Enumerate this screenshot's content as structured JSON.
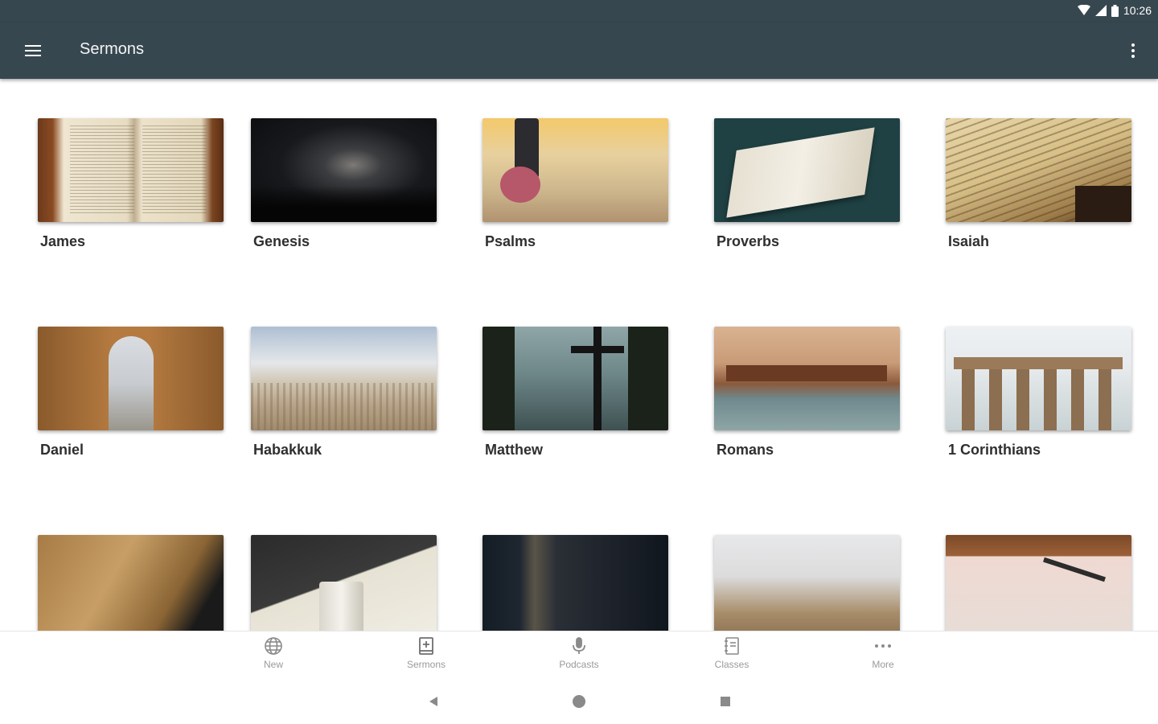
{
  "status_bar": {
    "time": "10:26",
    "icons": [
      "wifi-icon",
      "cell-signal-icon",
      "battery-icon"
    ]
  },
  "app_bar": {
    "title": "Sermons",
    "menu_icon": "hamburger-menu-icon",
    "overflow_icon": "more-vert-icon"
  },
  "series": [
    {
      "label": "James"
    },
    {
      "label": "Genesis"
    },
    {
      "label": "Psalms"
    },
    {
      "label": "Proverbs"
    },
    {
      "label": "Isaiah"
    },
    {
      "label": "Daniel"
    },
    {
      "label": "Habakkuk"
    },
    {
      "label": "Matthew"
    },
    {
      "label": "Romans"
    },
    {
      "label": "1 Corinthians"
    },
    {
      "label": ""
    },
    {
      "label": ""
    },
    {
      "label": ""
    },
    {
      "label": ""
    },
    {
      "label": ""
    }
  ],
  "bottom_nav": [
    {
      "label": "New",
      "icon": "globe-icon"
    },
    {
      "label": "Sermons",
      "icon": "book-plus-icon"
    },
    {
      "label": "Podcasts",
      "icon": "microphone-icon"
    },
    {
      "label": "Classes",
      "icon": "notebook-icon"
    },
    {
      "label": "More",
      "icon": "more-horiz-icon"
    }
  ],
  "system_nav": {
    "back_icon": "back-icon",
    "home_icon": "home-icon",
    "recents_icon": "recents-icon"
  },
  "colors": {
    "app_bar": "#37474f",
    "label_text": "#2f2f2f",
    "nav_inactive": "#9a9a9a"
  }
}
